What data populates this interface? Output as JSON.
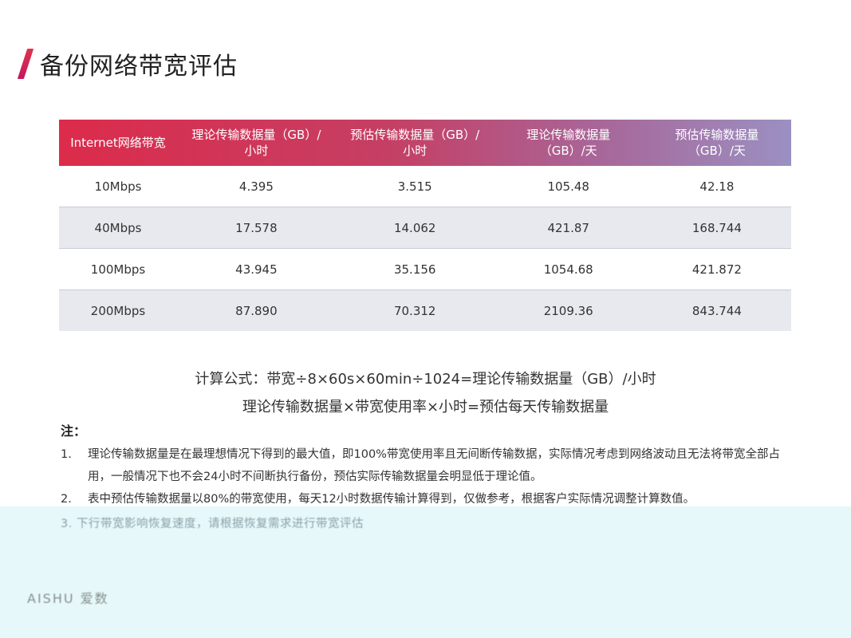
{
  "title": "备份网络带宽评估",
  "table": {
    "headers": [
      "Internet网络带宽",
      "理论传输数据量（GB）/小时",
      "预估传输数据量（GB）/小时",
      "理论传输数据量（GB）/天",
      "预估传输数据量（GB）/天"
    ],
    "rows": [
      [
        "10Mbps",
        "4.395",
        "3.515",
        "105.48",
        "42.18"
      ],
      [
        "40Mbps",
        "17.578",
        "14.062",
        "421.87",
        "168.744"
      ],
      [
        "100Mbps",
        "43.945",
        "35.156",
        "1054.68",
        "421.872"
      ],
      [
        "200Mbps",
        "87.890",
        "70.312",
        "2109.36",
        "843.744"
      ]
    ]
  },
  "formula": {
    "line1": "计算公式：带宽÷8×60s×60min÷1024=理论传输数据量（GB）/小时",
    "line2": "理论传输数据量×带宽使用率×小时=预估每天传输数据量"
  },
  "notes": {
    "title": "注：",
    "items": [
      {
        "num": "1.",
        "text": "理论传输数据量是在最理想情况下得到的最大值，即100%带宽使用率且无间断传输数据，实际情况考虑到网络波动且无法将带宽全部占用，一般情况下也不会24小时不间断执行备份，预估实际传输数据量会明显低于理论值。"
      },
      {
        "num": "2.",
        "text": "表中预估传输数据量以80%的带宽使用，每天12小时数据传输计算得到，仅做参考，根据客户实际情况调整计算数值。"
      }
    ],
    "item3": "3.  下行带宽影响恢复速度，请根据恢复需求进行带宽评估"
  },
  "footer": {
    "logo": "AISHU 爱数"
  }
}
